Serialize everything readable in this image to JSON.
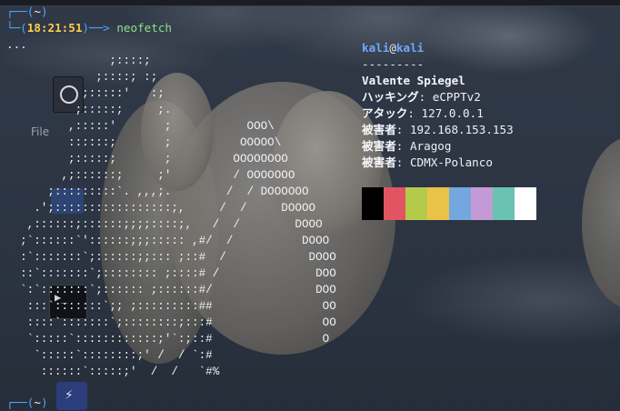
{
  "wallpaper": {
    "description": ""
  },
  "desktop_icons": [
    {
      "name": "file-manager-icon",
      "label": "File"
    },
    {
      "name": "folder-icon",
      "label": ""
    },
    {
      "name": "terminal-icon",
      "label": ""
    },
    {
      "name": "bolt-icon",
      "label": ""
    }
  ],
  "terminal": {
    "prompt1": {
      "top_frame": "┌──(",
      "tilde": "~",
      "top_close": ")",
      "bottom_frame": "└─(",
      "time": "18:21:51",
      "arrow": ")──> ",
      "command": "neofetch"
    },
    "ellipsis_line": "...",
    "ascii_art": "               ;::::;\n             ;::::; :;\n           ;:::::'   :;\n          ;:::::;     ;.\n         ,:::::'       ;           OOO\\\n         ::::::;       ;          OOOOO\\\n         ;:::::;       ;         OOOOOOOO\n        ,;::::::;     ;'         / OOOOOOO\n      ;:::::::::`. ,,,;.        /  / DOOOOOO\n    .';:::::::::::::::::;,     /  /     DOOOO\n   ,::::::;::::::;;;;::::;,   /  /        DOOO\n  ;`::::::`'::::::;;;::::: ,#/  /          DOOO\n  :`:::::::`;::::::;;::: ;::#  /            DOOO\n  ::`:::::::`;:::::::: ;::::# /              DOO\n  `:`:::::::`;:::::: ;::::::#/               DOO\n   :::`:::::::`;; ;:::::::::##                OO\n   ::::`:::::::`;::::::::;:::#                OO\n   `:::::`::::::::::::;'`:;::#                O\n    `:::::`::::::::;' /  / `:#\n     ::::::`:::::;'  /  /   `#%",
    "prompt2": {
      "top_frame": "┌──(",
      "tilde": "~",
      "top_close": ")"
    }
  },
  "neofetch": {
    "user": "kali",
    "at": "@",
    "host": "kali",
    "separator": "---------",
    "rows": [
      {
        "key": "Valente Spiegel",
        "value": ""
      },
      {
        "key": "ハッキング",
        "value": ": eCPPTv2"
      },
      {
        "key": "アタック",
        "value": ": 127.0.0.1"
      },
      {
        "key": "被害者",
        "value": ": 192.168.153.153"
      },
      {
        "key": "被害者",
        "value": ": Aragog"
      },
      {
        "key": "被害者",
        "value": ": CDMX-Polanco"
      }
    ],
    "palette": [
      "#000000",
      "#e05561",
      "#b5c94b",
      "#ebc248",
      "#73a7de",
      "#c49ad6",
      "#6ac2b0",
      "#ffffff"
    ]
  }
}
